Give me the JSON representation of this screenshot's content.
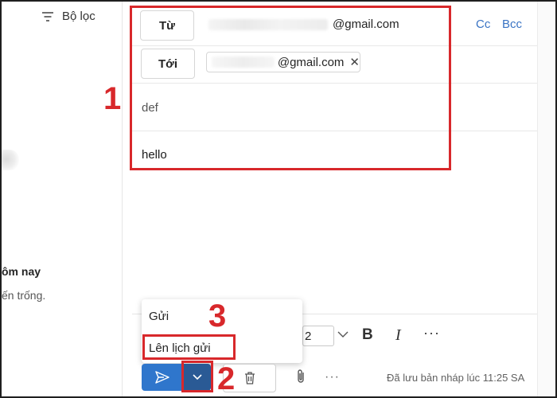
{
  "sidebar": {
    "filter_label": "Bộ lọc",
    "today_label": "ôm nay",
    "empty_label": "ến trống."
  },
  "compose": {
    "from_label": "Từ",
    "from_value": "@gmail.com",
    "cc_label": "Cc",
    "bcc_label": "Bcc",
    "to_label": "Tới",
    "to_chip": "@gmail.com",
    "subject": "def",
    "body": "hello"
  },
  "toolbar": {
    "font_size": "2",
    "bold": "B",
    "italic": "I",
    "more": "···"
  },
  "send_menu": {
    "send": "Gửi",
    "schedule_send": "Lên lịch gửi"
  },
  "bottom_bar": {
    "more": "···",
    "saved_status": "Đã lưu bản nháp lúc 11:25 SA"
  },
  "annotations": {
    "step1": "1",
    "step2": "2",
    "step3": "3",
    "color": "#d8282b"
  },
  "colors": {
    "send_button": "#2f76cc",
    "send_options": "#2a5a95",
    "link": "#3a74c4"
  }
}
